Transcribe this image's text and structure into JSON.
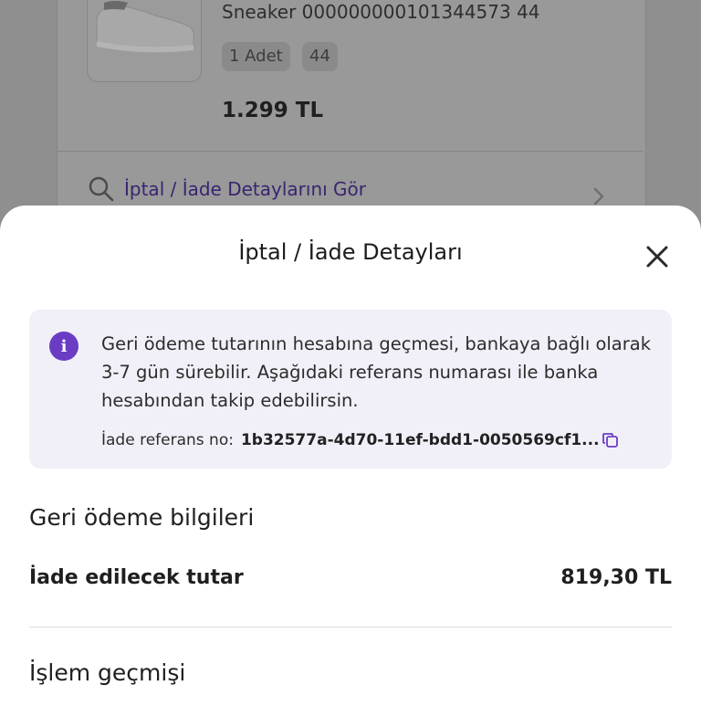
{
  "background": {
    "product": {
      "name": "Sneaker 000000000101344573 44",
      "quantity": "1 Adet",
      "size": "44",
      "price": "1.299 TL"
    },
    "details_link": "İptal / İade Detaylarını Gör",
    "colors": {
      "overlay": "#8f8f8f",
      "link": "#3a2470"
    }
  },
  "sheet": {
    "title": "İptal / İade Detayları",
    "close_icon": "close-icon",
    "info": {
      "icon": "info-icon",
      "message": "Geri ödeme tutarının hesabına geçmesi, bankaya bağlı olarak 3-7 gün sürebilir. Aşağıdaki referans numarası ile banka hesabından takip edebilirsin.",
      "reference_label": "İade referans no:",
      "reference_value": "1b32577a-4d70-11ef-bdd1-0050569cf1...",
      "copy_icon": "copy-icon"
    },
    "refund_info": {
      "title": "Geri ödeme bilgileri",
      "amount_label": "İade edilecek tutar",
      "amount_value": "819,30 TL"
    },
    "history": {
      "title": "İşlem geçmişi"
    },
    "colors": {
      "accent": "#6a3cc4",
      "info_bg": "#f1f0f8"
    }
  }
}
